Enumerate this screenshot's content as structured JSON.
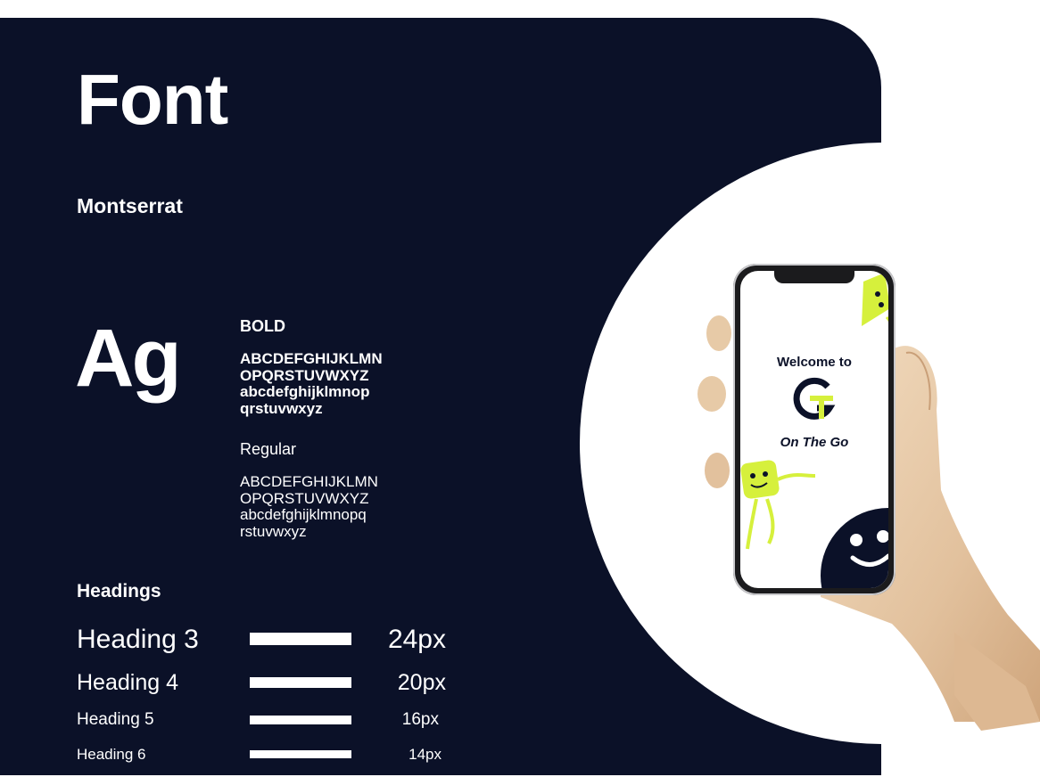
{
  "title": "Font",
  "font_name": "Montserrat",
  "specimen": "Ag",
  "weights": [
    {
      "label": "BOLD",
      "lines": [
        "ABCDEFGHIJKLMN",
        "OPQRSTUVWXYZ",
        "abcdefghijklmnop",
        "qrstuvwxyz"
      ]
    },
    {
      "label": "Regular",
      "lines": [
        "ABCDEFGHIJKLMN",
        "OPQRSTUVWXYZ",
        "abcdefghijklmnopq",
        "rstuvwxyz"
      ]
    }
  ],
  "headings_title": "Headings",
  "headings": [
    {
      "label": "Heading 3",
      "size": "24px"
    },
    {
      "label": "Heading 4",
      "size": "20px"
    },
    {
      "label": "Heading 5",
      "size": "16px"
    },
    {
      "label": "Heading 6",
      "size": "14px"
    }
  ],
  "phone": {
    "welcome": "Welcome to",
    "app_name": "On The Go"
  },
  "colors": {
    "navy": "#0b1128",
    "accent_lime": "#d6f03c",
    "white": "#ffffff"
  }
}
